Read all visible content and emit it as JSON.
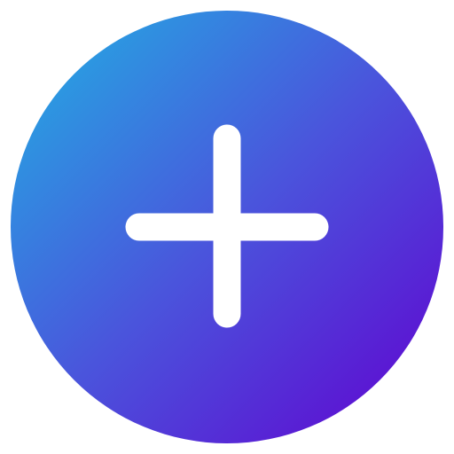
{
  "button": {
    "icon": "plus-icon",
    "gradient_start": "#20b2e3",
    "gradient_end": "#6100d0",
    "icon_color": "#ffffff"
  }
}
